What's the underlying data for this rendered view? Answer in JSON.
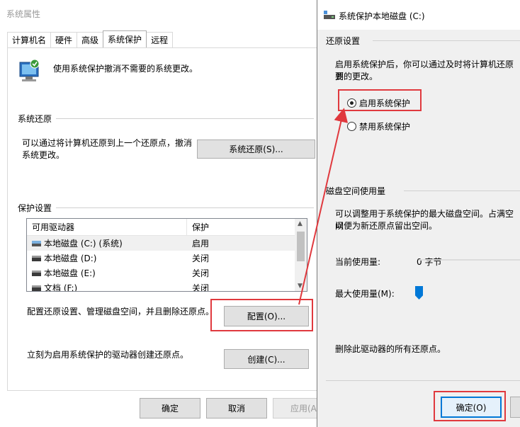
{
  "window1": {
    "title": "系统属性",
    "tabs": [
      "计算机名",
      "硬件",
      "高级",
      "系统保护",
      "远程"
    ],
    "header_text": "使用系统保护撤消不需要的系统更改。",
    "restore_group": {
      "label": "系统还原",
      "text_line1": "可以通过将计算机还原到上一个还原点，撤消",
      "text_line2": "系统更改。",
      "button": "系统还原(S)..."
    },
    "protection_group": {
      "label": "保护设置",
      "columns": [
        "可用驱动器",
        "保护"
      ],
      "rows": [
        {
          "drive": "本地磁盘 (C:) (系统)",
          "status": "启用"
        },
        {
          "drive": "本地磁盘 (D:)",
          "status": "关闭"
        },
        {
          "drive": "本地磁盘 (E:)",
          "status": "关闭"
        },
        {
          "drive": "文档 (F:)",
          "status": "关闭"
        }
      ],
      "configure_text": "配置还原设置、管理磁盘空间，并且删除还原点。",
      "configure_button": "配置(O)...",
      "create_text": "立刻为启用系统保护的驱动器创建还原点。",
      "create_button": "创建(C)..."
    },
    "buttons": {
      "ok": "确定",
      "cancel": "取消",
      "apply": "应用(A)"
    }
  },
  "window2": {
    "title": "系统保护本地磁盘 (C:)",
    "restore_settings": {
      "label": "还原设置",
      "text_line1": "启用系统保护后，你可以通过及时将计算机还原到",
      "text_line2": "要的更改。",
      "option_on": "启用系统保护",
      "option_off": "禁用系统保护",
      "selected": "启用系统保护"
    },
    "disk_usage": {
      "label": "磁盘空间使用量",
      "text_line1": "可以调整用于系统保护的最大磁盘空间。占满空间",
      "text_line2": "以便为新还原点留出空间。",
      "current_label": "当前使用量:",
      "current_value": "0 字节",
      "max_label": "最大使用量(M):",
      "delete_text": "删除此驱动器的所有还原点。"
    },
    "ok_button": "确定(O)"
  },
  "colors": {
    "highlight": "#e0393e",
    "accent": "#0078d7"
  }
}
